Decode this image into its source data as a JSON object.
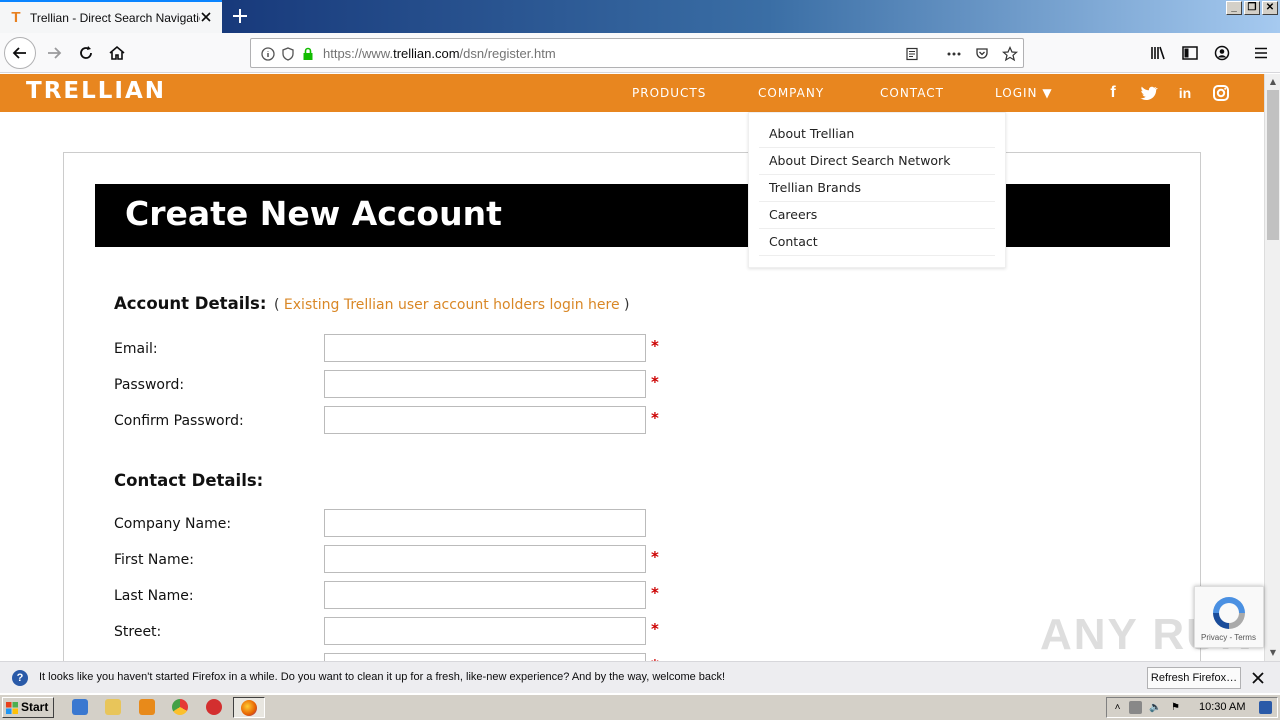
{
  "browser": {
    "tab_title": "Trellian - Direct Search Navigation",
    "url_prefix": "https://www.",
    "url_domain": "trellian.com",
    "url_path": "/dsn/register.htm"
  },
  "site": {
    "logo": "TRELLIAN",
    "nav": {
      "products": "PRODUCTS",
      "company": "COMPANY",
      "contact": "CONTACT",
      "login": "LOGIN ▼"
    },
    "social": [
      "facebook-icon",
      "twitter-icon",
      "linkedin-icon",
      "instagram-icon"
    ],
    "company_menu": [
      "About Trellian",
      "About Direct Search Network",
      "Trellian Brands",
      "Careers",
      "Contact"
    ]
  },
  "form": {
    "banner_title": "Create New Account",
    "account_heading": "Account Details:",
    "login_link_open": "( ",
    "login_link": "Existing Trellian user account holders login here",
    "login_link_close": " )",
    "account_fields": [
      {
        "label": "Email:",
        "value": "",
        "required": true
      },
      {
        "label": "Password:",
        "value": "",
        "required": true
      },
      {
        "label": "Confirm Password:",
        "value": "",
        "required": true
      }
    ],
    "contact_heading": "Contact Details:",
    "contact_fields": [
      {
        "label": "Company Name:",
        "value": "",
        "required": false
      },
      {
        "label": "First Name:",
        "value": "",
        "required": true
      },
      {
        "label": "Last Name:",
        "value": "",
        "required": true
      },
      {
        "label": "Street:",
        "value": "",
        "required": true
      }
    ],
    "required_mark": "*"
  },
  "recaptcha": {
    "terms": "Privacy - Terms"
  },
  "watermark": "ANY RUN",
  "notification": {
    "text": "It looks like you haven't started Firefox in a while. Do you want to clean it up for a fresh, like-new experience? And by the way, welcome back!",
    "button": "Refresh Firefox…"
  },
  "taskbar": {
    "start": "Start",
    "clock": "10:30 AM"
  },
  "colors": {
    "brand_orange": "#e8861f",
    "link_orange": "#d98726",
    "required_red": "#cc0000"
  }
}
